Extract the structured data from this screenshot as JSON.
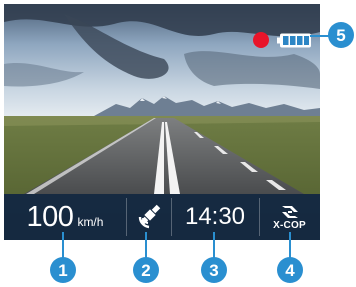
{
  "status_bar": {
    "speed_value": "100",
    "speed_unit": "km/h",
    "time": "14:30",
    "brand": "X-COP",
    "gps_icon": "satellite-icon",
    "brand_icon": "x-cop-logo-icon"
  },
  "indicators": {
    "recording_icon": "recording-dot-icon",
    "battery_icon": "battery-full-icon",
    "battery_level": 1.0
  },
  "callouts": [
    "1",
    "2",
    "3",
    "4",
    "5"
  ],
  "colors": {
    "accent": "#2a8fd0",
    "recording": "#e8142a",
    "bar_background": "#102542"
  }
}
